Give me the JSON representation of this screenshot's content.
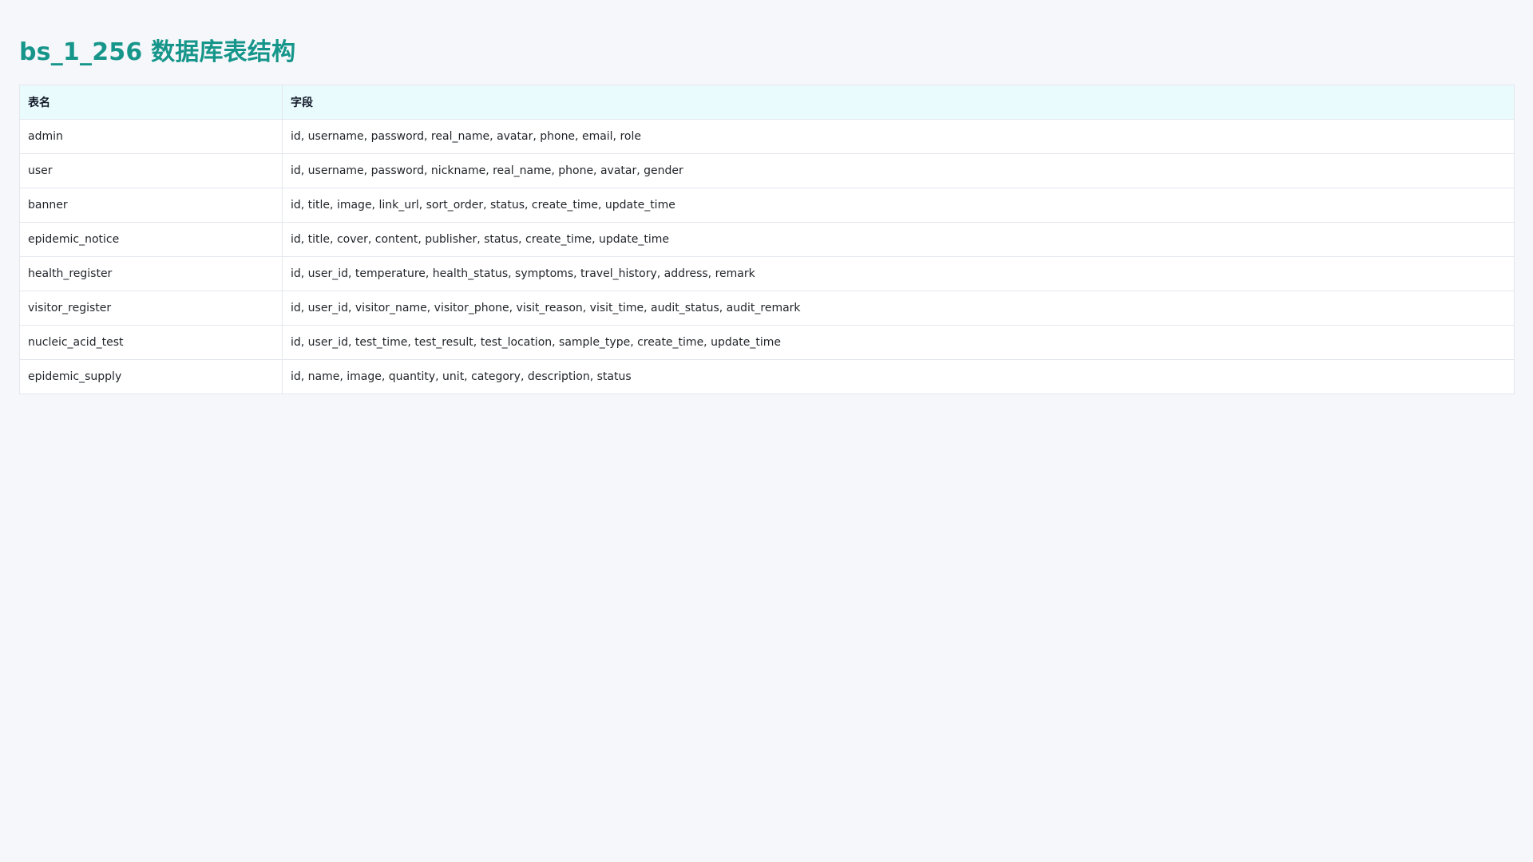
{
  "page": {
    "title": "bs_1_256 数据库表结构",
    "accent_color": "#16968a"
  },
  "table": {
    "headers": {
      "table_name": "表名",
      "fields": "字段"
    },
    "rows": [
      {
        "table_name": "admin",
        "fields": "id, username, password, real_name, avatar, phone, email, role"
      },
      {
        "table_name": "user",
        "fields": "id, username, password, nickname, real_name, phone, avatar, gender"
      },
      {
        "table_name": "banner",
        "fields": "id, title, image, link_url, sort_order, status, create_time, update_time"
      },
      {
        "table_name": "epidemic_notice",
        "fields": "id, title, cover, content, publisher, status, create_time, update_time"
      },
      {
        "table_name": "health_register",
        "fields": "id, user_id, temperature, health_status, symptoms, travel_history, address, remark"
      },
      {
        "table_name": "visitor_register",
        "fields": "id, user_id, visitor_name, visitor_phone, visit_reason, visit_time, audit_status, audit_remark"
      },
      {
        "table_name": "nucleic_acid_test",
        "fields": "id, user_id, test_time, test_result, test_location, sample_type, create_time, update_time"
      },
      {
        "table_name": "epidemic_supply",
        "fields": "id, name, image, quantity, unit, category, description, status"
      }
    ]
  }
}
